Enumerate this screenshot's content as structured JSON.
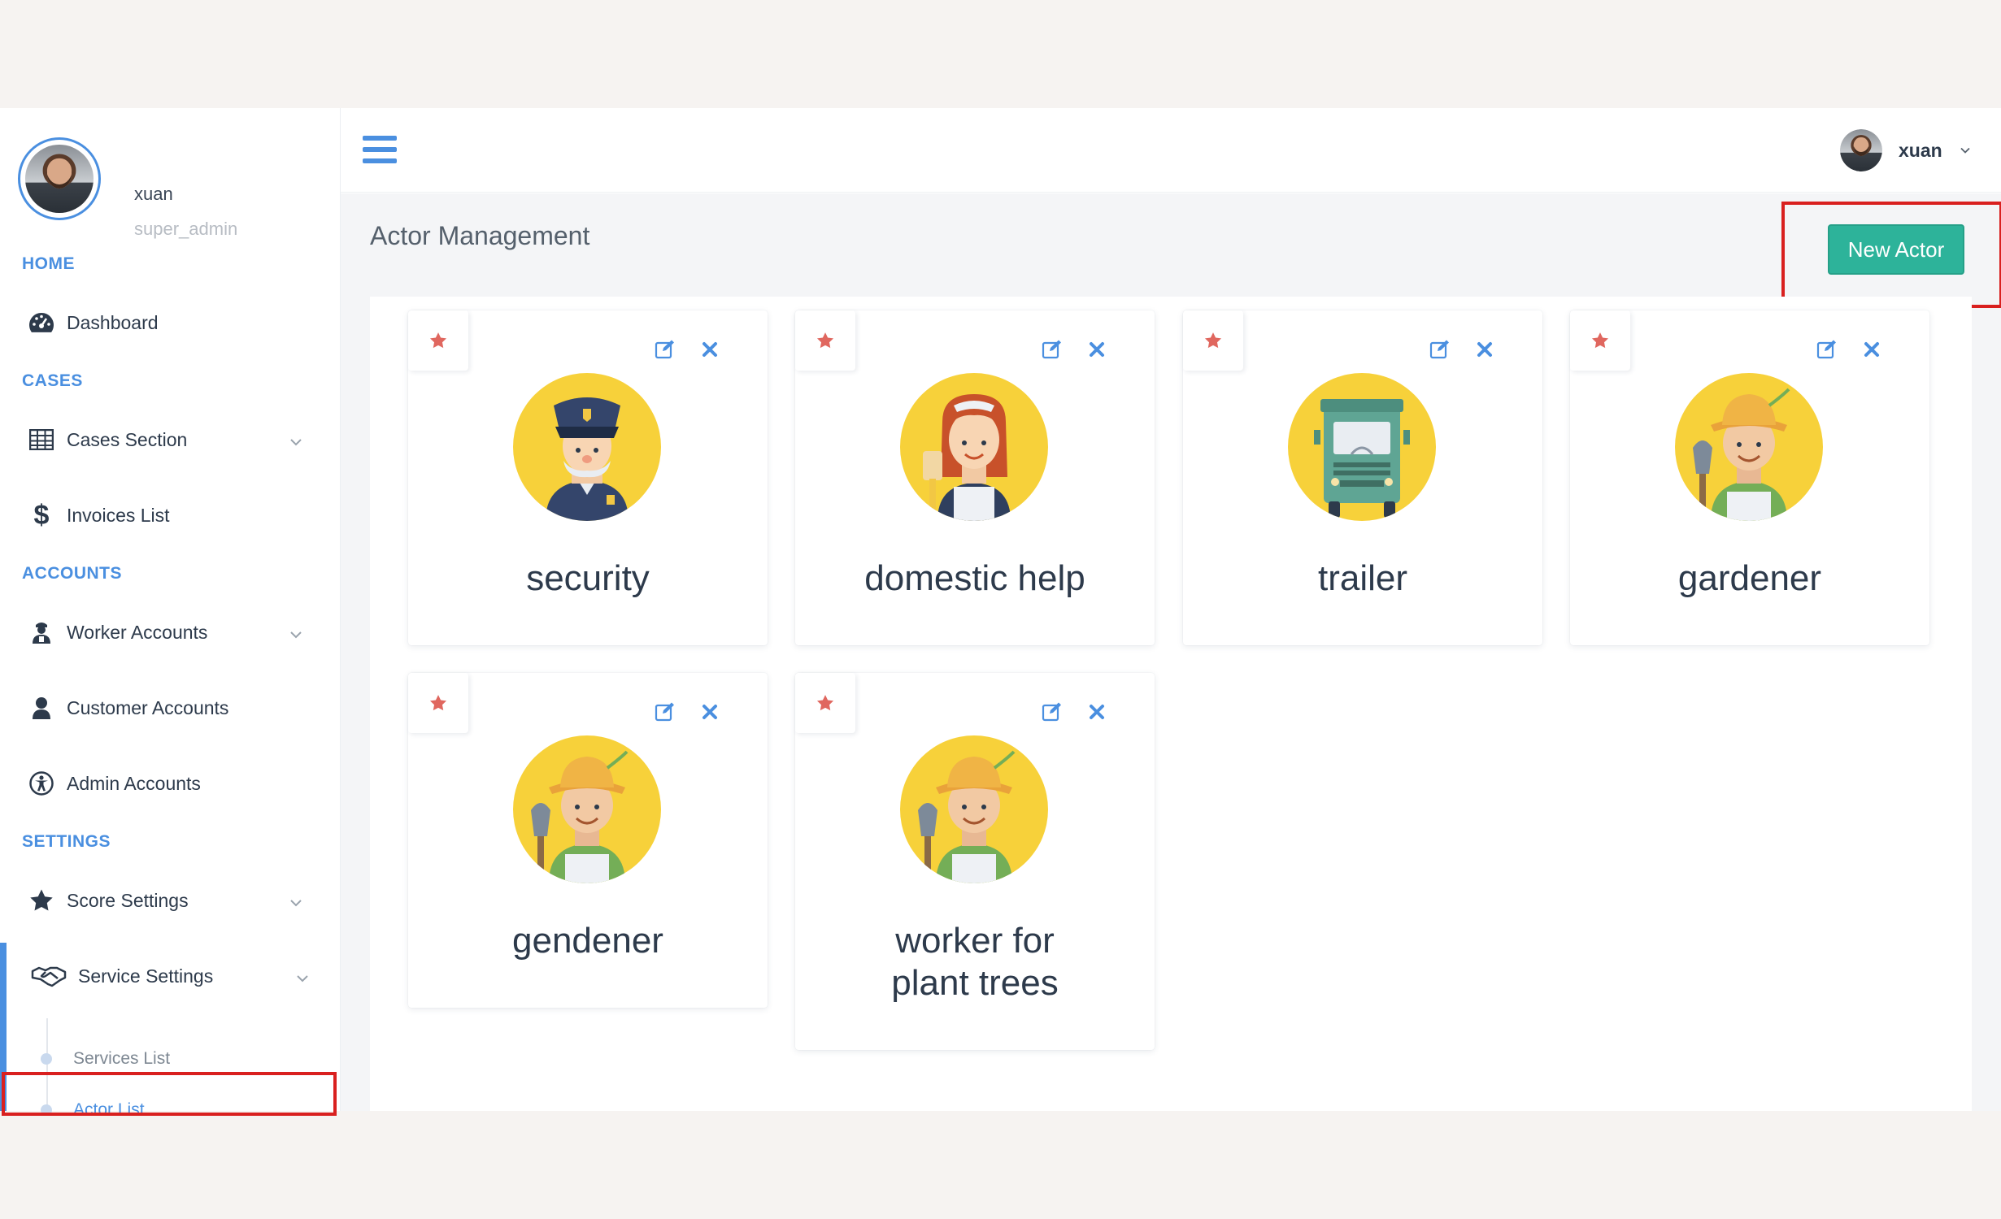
{
  "user": {
    "name": "xuan",
    "role": "super_admin"
  },
  "sidebar": {
    "sections": {
      "home": "HOME",
      "cases": "CASES",
      "accounts": "ACCOUNTS",
      "settings": "SETTINGS"
    },
    "items": {
      "dashboard": "Dashboard",
      "cases_section": "Cases Section",
      "invoices_list": "Invoices List",
      "worker_accounts": "Worker Accounts",
      "customer_accounts": "Customer Accounts",
      "admin_accounts": "Admin Accounts",
      "score_settings": "Score Settings",
      "service_settings": "Service Settings",
      "services_list": "Services List",
      "actor_list": "Actor List"
    }
  },
  "page": {
    "title": "Actor Management",
    "new_button": "New Actor"
  },
  "actors": [
    {
      "label": "security",
      "icon": "police-officer-icon"
    },
    {
      "label": "domestic help",
      "icon": "housekeeper-icon"
    },
    {
      "label": "trailer",
      "icon": "truck-icon"
    },
    {
      "label": "gardener",
      "icon": "gardener-icon"
    },
    {
      "label": "gendener",
      "icon": "gardener-icon"
    },
    {
      "label": "worker for plant trees",
      "icon": "gardener-icon"
    }
  ],
  "colors": {
    "accent": "#4a8fe0",
    "primary_button": "#2db39a",
    "star": "#e0675f",
    "avatar_bg": "#f7d13a",
    "highlight": "#d9201f"
  }
}
